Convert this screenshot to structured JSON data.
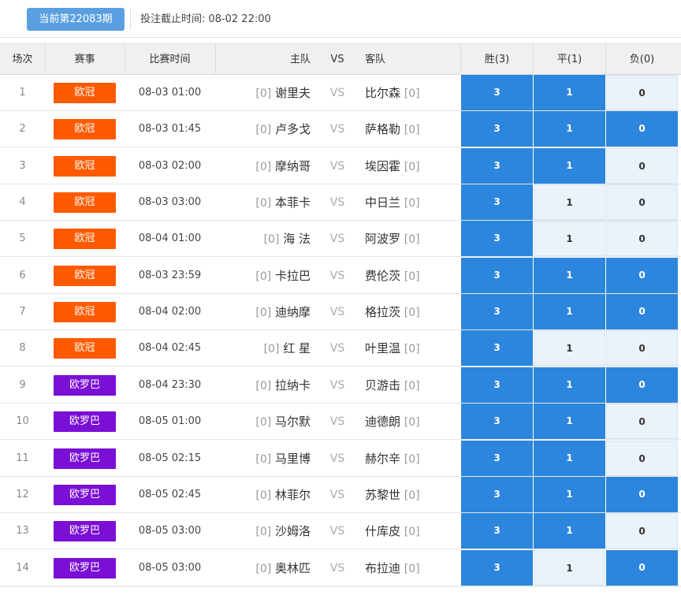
{
  "header": {
    "period_label": "当前第22083期",
    "deadline_label": "投注截止时间:",
    "deadline_value": "08-02 22:00"
  },
  "table": {
    "columns": {
      "index": "场次",
      "league": "赛事",
      "time": "比赛时间",
      "home": "主队",
      "vs": "VS",
      "away": "客队",
      "win": "胜(3)",
      "draw": "平(1)",
      "lose": "负(0)"
    },
    "colors": {
      "ucl": "#ff5a00",
      "uel": "#7a0fd6",
      "selected": "#2d86dd",
      "unselected": "#eaf2fa"
    },
    "rows": [
      {
        "idx": "1",
        "league": "欧冠",
        "league_type": "ucl",
        "time": "08-03 01:00",
        "home_hc": "[0]",
        "home": "谢里夫",
        "vs": "VS",
        "away": "比尔森",
        "away_hc": "[0]",
        "win": "3",
        "draw": "1",
        "lose": "0",
        "sel": [
          true,
          true,
          false
        ]
      },
      {
        "idx": "2",
        "league": "欧冠",
        "league_type": "ucl",
        "time": "08-03 01:45",
        "home_hc": "[0]",
        "home": "卢多戈",
        "vs": "VS",
        "away": "萨格勒",
        "away_hc": "[0]",
        "win": "3",
        "draw": "1",
        "lose": "0",
        "sel": [
          true,
          true,
          true
        ]
      },
      {
        "idx": "3",
        "league": "欧冠",
        "league_type": "ucl",
        "time": "08-03 02:00",
        "home_hc": "[0]",
        "home": "摩纳哥",
        "vs": "VS",
        "away": "埃因霍",
        "away_hc": "[0]",
        "win": "3",
        "draw": "1",
        "lose": "0",
        "sel": [
          true,
          true,
          false
        ]
      },
      {
        "idx": "4",
        "league": "欧冠",
        "league_type": "ucl",
        "time": "08-03 03:00",
        "home_hc": "[0]",
        "home": "本菲卡",
        "vs": "VS",
        "away": "中日兰",
        "away_hc": "[0]",
        "win": "3",
        "draw": "1",
        "lose": "0",
        "sel": [
          true,
          false,
          false
        ]
      },
      {
        "idx": "5",
        "league": "欧冠",
        "league_type": "ucl",
        "time": "08-04 01:00",
        "home_hc": "[0]",
        "home": "海 法",
        "vs": "VS",
        "away": "阿波罗",
        "away_hc": "[0]",
        "win": "3",
        "draw": "1",
        "lose": "0",
        "sel": [
          true,
          false,
          false
        ]
      },
      {
        "idx": "6",
        "league": "欧冠",
        "league_type": "ucl",
        "time": "08-03 23:59",
        "home_hc": "[0]",
        "home": "卡拉巴",
        "vs": "VS",
        "away": "费伦茨",
        "away_hc": "[0]",
        "win": "3",
        "draw": "1",
        "lose": "0",
        "sel": [
          true,
          true,
          true
        ]
      },
      {
        "idx": "7",
        "league": "欧冠",
        "league_type": "ucl",
        "time": "08-04 02:00",
        "home_hc": "[0]",
        "home": "迪纳摩",
        "vs": "VS",
        "away": "格拉茨",
        "away_hc": "[0]",
        "win": "3",
        "draw": "1",
        "lose": "0",
        "sel": [
          true,
          true,
          true
        ]
      },
      {
        "idx": "8",
        "league": "欧冠",
        "league_type": "ucl",
        "time": "08-04 02:45",
        "home_hc": "[0]",
        "home": "红 星",
        "vs": "VS",
        "away": "叶里温",
        "away_hc": "[0]",
        "win": "3",
        "draw": "1",
        "lose": "0",
        "sel": [
          true,
          false,
          false
        ]
      },
      {
        "idx": "9",
        "league": "欧罗巴",
        "league_type": "uel",
        "time": "08-04 23:30",
        "home_hc": "[0]",
        "home": "拉纳卡",
        "vs": "VS",
        "away": "贝游击",
        "away_hc": "[0]",
        "win": "3",
        "draw": "1",
        "lose": "0",
        "sel": [
          true,
          true,
          true
        ]
      },
      {
        "idx": "10",
        "league": "欧罗巴",
        "league_type": "uel",
        "time": "08-05 01:00",
        "home_hc": "[0]",
        "home": "马尔默",
        "vs": "VS",
        "away": "迪德朗",
        "away_hc": "[0]",
        "win": "3",
        "draw": "1",
        "lose": "0",
        "sel": [
          true,
          true,
          false
        ]
      },
      {
        "idx": "11",
        "league": "欧罗巴",
        "league_type": "uel",
        "time": "08-05 02:15",
        "home_hc": "[0]",
        "home": "马里博",
        "vs": "VS",
        "away": "赫尔辛",
        "away_hc": "[0]",
        "win": "3",
        "draw": "1",
        "lose": "0",
        "sel": [
          true,
          true,
          false
        ]
      },
      {
        "idx": "12",
        "league": "欧罗巴",
        "league_type": "uel",
        "time": "08-05 02:45",
        "home_hc": "[0]",
        "home": "林菲尔",
        "vs": "VS",
        "away": "苏黎世",
        "away_hc": "[0]",
        "win": "3",
        "draw": "1",
        "lose": "0",
        "sel": [
          true,
          true,
          true
        ]
      },
      {
        "idx": "13",
        "league": "欧罗巴",
        "league_type": "uel",
        "time": "08-05 03:00",
        "home_hc": "[0]",
        "home": "沙姆洛",
        "vs": "VS",
        "away": "什库皮",
        "away_hc": "[0]",
        "win": "3",
        "draw": "1",
        "lose": "0",
        "sel": [
          true,
          true,
          false
        ]
      },
      {
        "idx": "14",
        "league": "欧罗巴",
        "league_type": "uel",
        "time": "08-05 03:00",
        "home_hc": "[0]",
        "home": "奥林匹",
        "vs": "VS",
        "away": "布拉迪",
        "away_hc": "[0]",
        "win": "3",
        "draw": "1",
        "lose": "0",
        "sel": [
          true,
          false,
          true
        ]
      }
    ]
  }
}
